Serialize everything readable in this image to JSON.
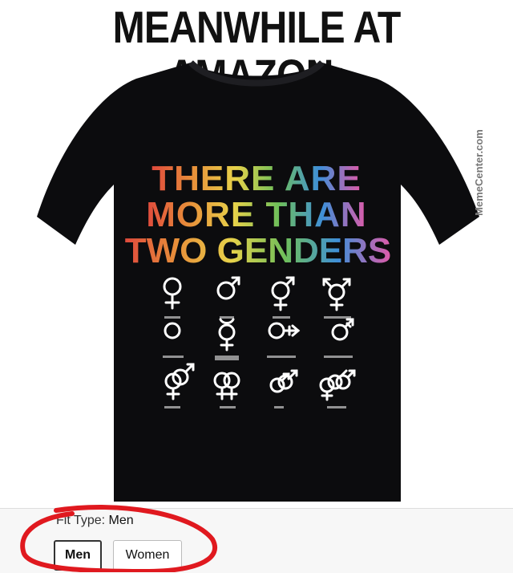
{
  "headline": "MEANWHILE AT AMAZON:",
  "shirt": {
    "slogan_lines": [
      "THERE ARE",
      "MORE THAN",
      "TWO GENDERS"
    ],
    "symbols": [
      [
        "female-symbol",
        "male-symbol",
        "intersex-symbol",
        "transgender-symbol"
      ],
      [
        "genderless-symbol",
        "non-binary-transgender-symbol",
        "other-gender-symbol",
        "transgender-symbol"
      ],
      [
        "hetero-symbol",
        "lesbian-symbol",
        "gay-symbol",
        "bisexual-symbol"
      ]
    ],
    "colors": {
      "shirt": "#0c0c0e",
      "red": "#e04a3c",
      "orange": "#e8913a",
      "yellow": "#e7d24a",
      "green": "#6fbf5a",
      "blue": "#3f8fd8",
      "purple": "#a05bd0",
      "pink": "#e05aa8"
    }
  },
  "watermark": "MemeCenter.com",
  "fit": {
    "label": "Fit Type:",
    "selected": "Men",
    "options": [
      "Men",
      "Women"
    ],
    "highlight_color": "#e0191f"
  }
}
